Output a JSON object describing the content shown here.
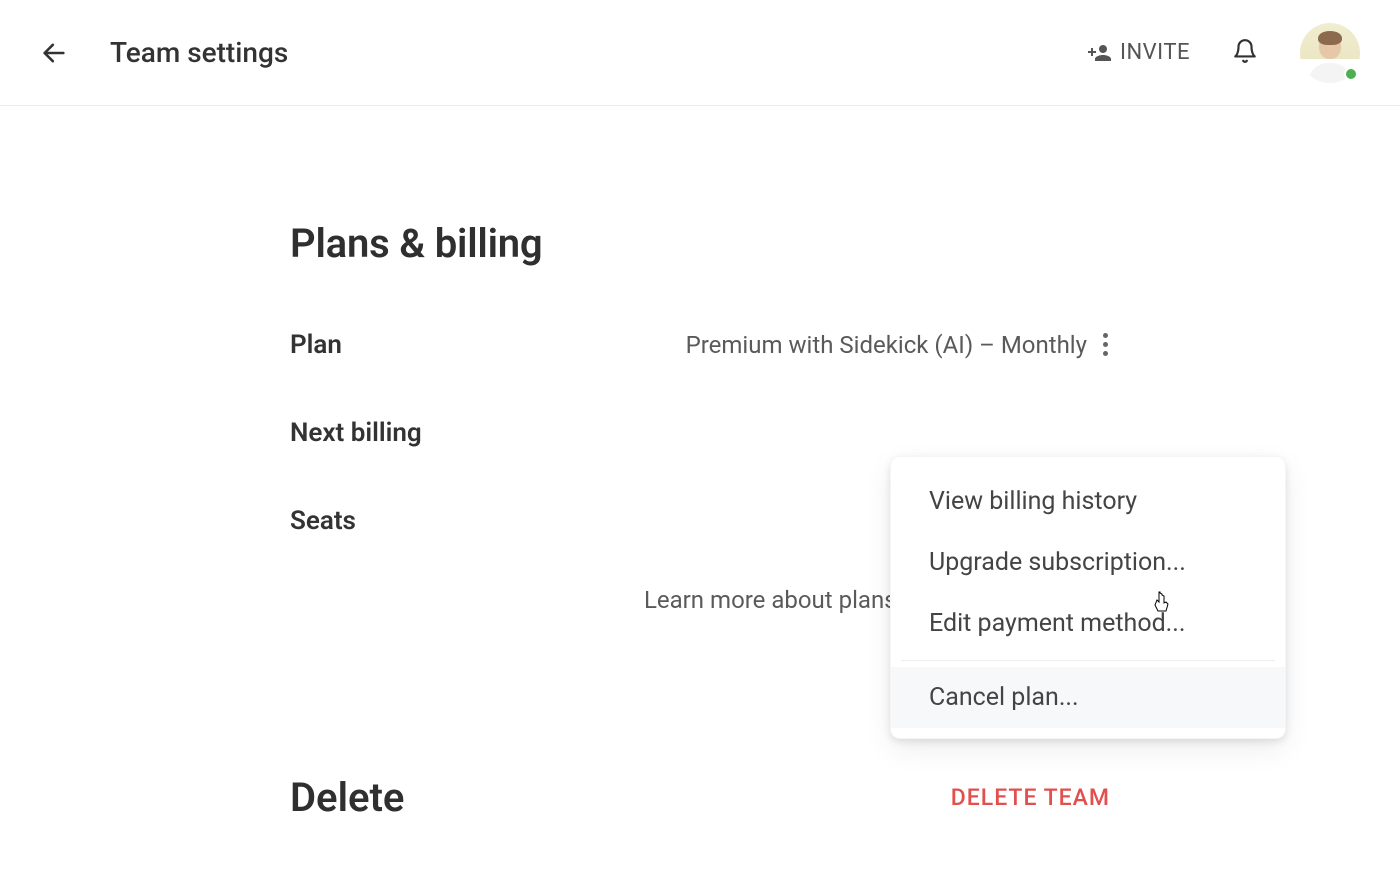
{
  "header": {
    "title": "Team settings",
    "invite_label": "INVITE"
  },
  "billing": {
    "heading": "Plans & billing",
    "rows": {
      "plan_label": "Plan",
      "plan_value": "Premium with Sidekick (AI) – Monthly",
      "next_billing_label": "Next billing",
      "seats_label": "Seats"
    },
    "learn_more": "Learn more about plans & pricing"
  },
  "menu": {
    "items": {
      "view_history": "View billing history",
      "upgrade": "Upgrade subscription...",
      "edit_payment": "Edit payment method...",
      "cancel": "Cancel plan..."
    }
  },
  "delete": {
    "heading": "Delete",
    "button": "DELETE TEAM"
  }
}
